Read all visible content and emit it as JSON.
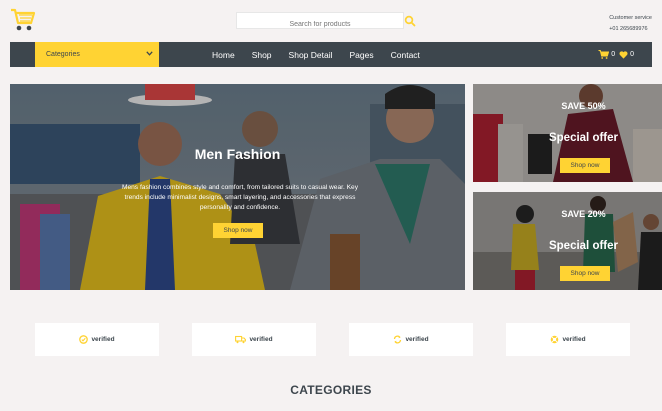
{
  "search": {
    "placeholder": "Search for products"
  },
  "customer_service": {
    "label": "Customer service",
    "phone": "+01 265689976"
  },
  "navbar": {
    "categories_label": "Categories",
    "links": [
      "Home",
      "Shop",
      "Shop Detail",
      "Pages",
      "Contact"
    ],
    "cart_count": "0",
    "wishlist_count": "0"
  },
  "hero": {
    "title": "Men Fashion",
    "description": "Mens fashion combines style and comfort, from tailored suits to casual wear. Key trends include minimalist designs, smart layering, and accessories that express personality and confidence.",
    "button": "Shop now"
  },
  "offers": [
    {
      "save": "SAVE 50%",
      "title": "Special offer",
      "button": "Shop now"
    },
    {
      "save": "SAVE 20%",
      "title": "Special offer",
      "button": "Shop now"
    }
  ],
  "features": [
    {
      "icon": "check-badge-icon",
      "label": "verified"
    },
    {
      "icon": "truck-icon",
      "label": "verified"
    },
    {
      "icon": "exchange-icon",
      "label": "verified"
    },
    {
      "icon": "support-icon",
      "label": "verified"
    }
  ],
  "section": {
    "categories_heading": "CATEGORIES"
  },
  "colors": {
    "accent": "#ffd333",
    "dark": "#3d464d",
    "background": "#f5f2f2"
  }
}
